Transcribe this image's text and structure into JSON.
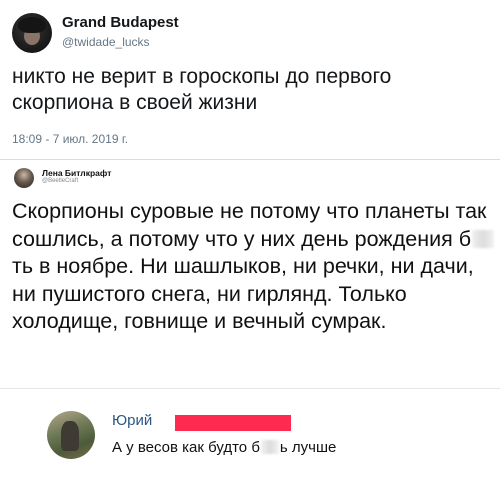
{
  "tweet1": {
    "display_name": "Grand Budapest",
    "handle": "@twidade_lucks",
    "text": "никто не верит в гороскопы до первого скорпиона в своей жизни",
    "timestamp": "18:09 - 7 июл. 2019 г."
  },
  "tweet2": {
    "display_name": "Лена Битлкрафт",
    "handle": "@BeetleCraft",
    "text_before_censor": "Скорпионы суровые не потому что планеты так сошлись, а потому что у них день рождения б",
    "text_after_censor": "ть в ноябре. Ни шашлыков, ни речки, ни дачи, ни пушистого снега, ни гирлянд. Только холодище, говнище и вечный сумрак."
  },
  "comment": {
    "author": "Юрий",
    "redaction_color": "#ff2a4f",
    "text_before_censor": "А у весов как будто б",
    "text_after_censor": "ь лучше"
  },
  "colors": {
    "handle_gray": "#657786",
    "comment_name_blue": "#2a5885"
  }
}
